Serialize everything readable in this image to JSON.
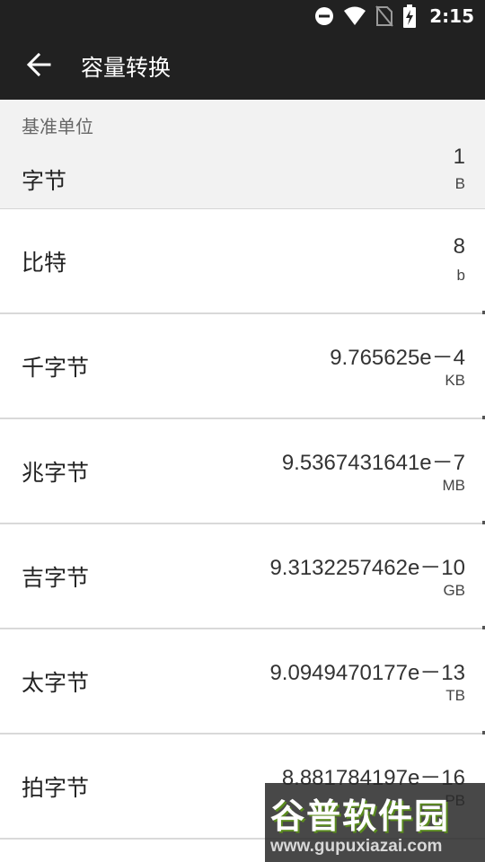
{
  "status_bar": {
    "time": "2:15",
    "icons": [
      "do-not-disturb-icon",
      "wifi-icon",
      "no-sim-icon",
      "battery-charging-icon"
    ]
  },
  "app_bar": {
    "title": "容量转换",
    "back_icon": "arrow-left-icon"
  },
  "base_section": {
    "header": "基准单位",
    "name": "字节",
    "value": "1",
    "unit": "B"
  },
  "rows": [
    {
      "name": "比特",
      "value": "8",
      "unit": "b"
    },
    {
      "name": "千字节",
      "value": "9.765625e－4",
      "unit": "KB"
    },
    {
      "name": "兆字节",
      "value": "9.5367431641e－7",
      "unit": "MB"
    },
    {
      "name": "吉字节",
      "value": "9.3132257462e－10",
      "unit": "GB"
    },
    {
      "name": "太字节",
      "value": "9.0949470177e－13",
      "unit": "TB"
    },
    {
      "name": "拍字节",
      "value": "8.881784197e－16",
      "unit": "PB"
    }
  ],
  "watermark": {
    "title": "谷普软件园",
    "url": "www.gupuxiazai.com"
  }
}
